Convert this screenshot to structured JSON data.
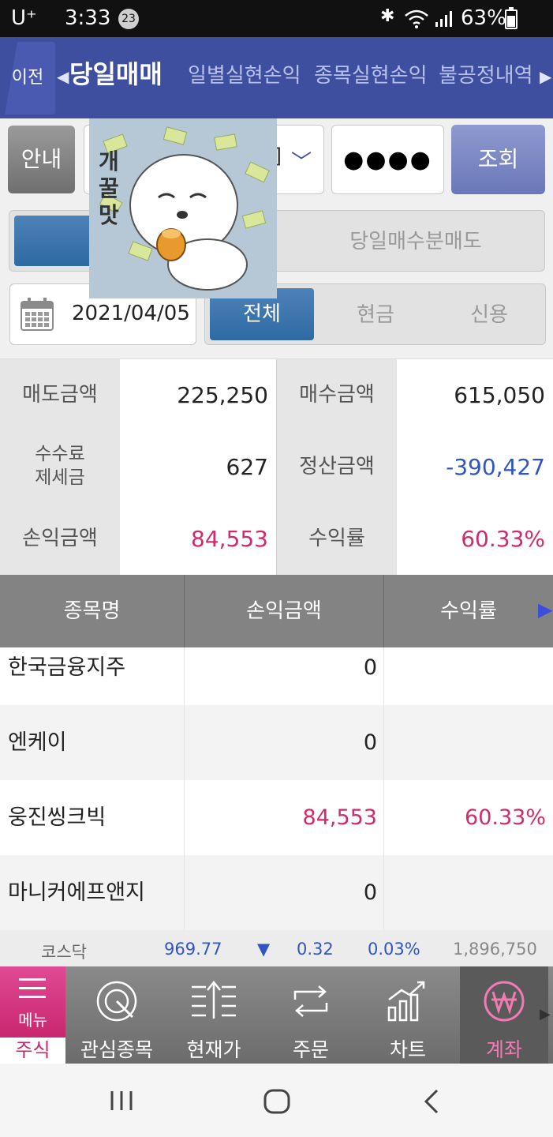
{
  "status_bar": {
    "carrier": "U⁺",
    "time": "3:33",
    "notification_count": "23",
    "battery": "63%"
  },
  "tabs": {
    "back_label": "이전",
    "items": [
      {
        "label": "당일매매",
        "active": true
      },
      {
        "label": "일별실현손익",
        "active": false
      },
      {
        "label": "종목실현손익",
        "active": false
      },
      {
        "label": "불공정내역",
        "active": false
      }
    ]
  },
  "search": {
    "guide_label": "안내",
    "account_partial": "]",
    "password": "●●●●",
    "query_label": "조회"
  },
  "sticker_text": "개꿀맛",
  "mode": {
    "option_day_buy_sell": "당일매수분매도"
  },
  "filter": {
    "date": "2021/04/05",
    "segments": [
      {
        "label": "전체",
        "active": true
      },
      {
        "label": "현금",
        "active": false
      },
      {
        "label": "신용",
        "active": false
      }
    ]
  },
  "summary": {
    "sell_amount_label": "매도금액",
    "sell_amount": "225,250",
    "buy_amount_label": "매수금액",
    "buy_amount": "615,050",
    "fee_tax_label_1": "수수료",
    "fee_tax_label_2": "제세금",
    "fee_tax": "627",
    "settlement_label": "정산금액",
    "settlement": "-390,427",
    "pnl_label": "손익금액",
    "pnl": "84,553",
    "return_label": "수익률",
    "return_rate": "60.33%"
  },
  "detail": {
    "headers": [
      "종목명",
      "손익금액",
      "수익률"
    ],
    "rows": [
      {
        "name": "한국금융지주",
        "pnl": "0",
        "rate": "",
        "highlight": false
      },
      {
        "name": "엔케이",
        "pnl": "0",
        "rate": "",
        "highlight": false
      },
      {
        "name": "웅진씽크빅",
        "pnl": "84,553",
        "rate": "60.33%",
        "highlight": true
      },
      {
        "name": "마니커에프앤지",
        "pnl": "0",
        "rate": "",
        "highlight": false
      }
    ]
  },
  "ticker": {
    "index_name": "코스닥",
    "value": "969.77",
    "direction": "▼",
    "change": "0.32",
    "change_pct": "0.03%",
    "volume": "1,896,750"
  },
  "bottom_nav": {
    "menu_label": "메뉴",
    "stock_label": "주식",
    "items": [
      {
        "label": "관심종목",
        "icon": "watchlist-icon"
      },
      {
        "label": "현재가",
        "icon": "current-price-icon"
      },
      {
        "label": "주문",
        "icon": "order-icon"
      },
      {
        "label": "차트",
        "icon": "chart-icon"
      },
      {
        "label": "계좌",
        "icon": "won-icon",
        "active": true
      }
    ]
  },
  "colors": {
    "primary": "#3d4f9e",
    "profit": "#d12a6e",
    "loss": "#2f55c5",
    "menu": "#c9276f"
  }
}
